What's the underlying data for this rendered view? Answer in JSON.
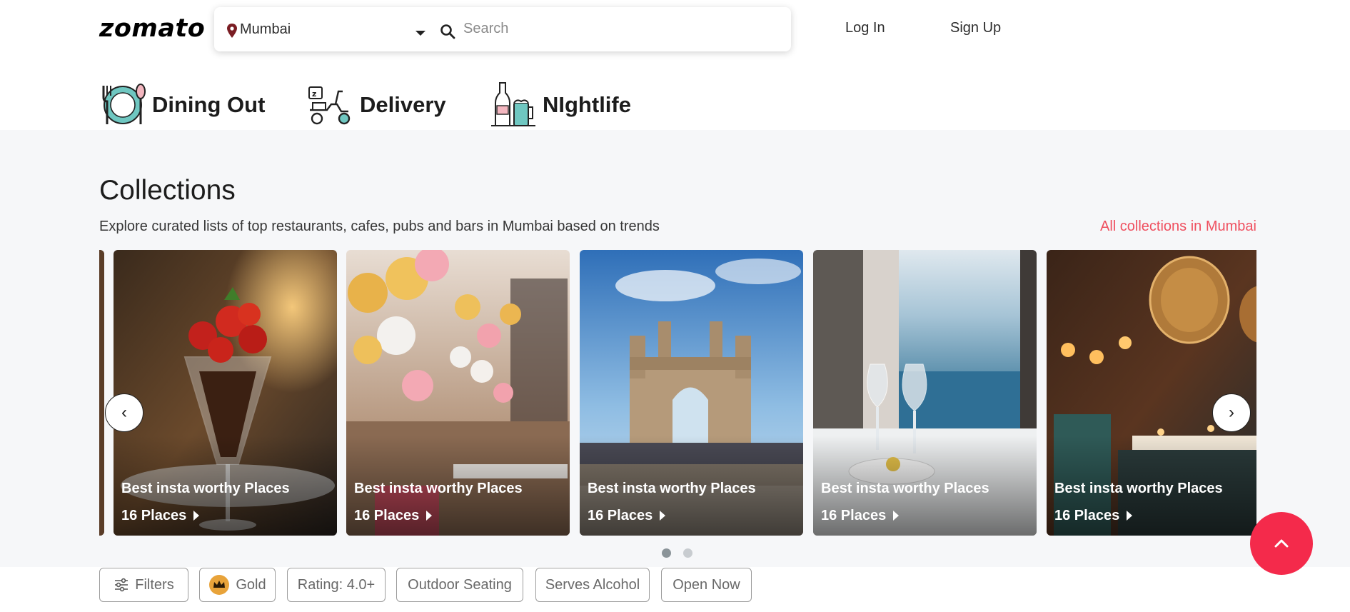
{
  "header": {
    "logo": "zomato",
    "location": "Mumbai",
    "search_placeholder": "Search",
    "login": "Log In",
    "signup": "Sign Up"
  },
  "categories": [
    {
      "label": "Dining Out",
      "icon": "dining-out-icon"
    },
    {
      "label": "Delivery",
      "icon": "delivery-scooter-icon"
    },
    {
      "label": "NIghtlife",
      "icon": "nightlife-drinks-icon"
    }
  ],
  "collections": {
    "title": "Collections",
    "subtitle": "Explore curated lists of top restaurants, cafes, pubs and bars in Mumbai based on trends",
    "link": "All collections in Mumbai",
    "cards": [
      {
        "title": "Best insta worthy Places",
        "count": "16 Places"
      },
      {
        "title": "Best insta worthy Places",
        "count": "16 Places"
      },
      {
        "title": "Best insta worthy Places",
        "count": "16 Places"
      },
      {
        "title": "Best insta worthy Places",
        "count": "16 Places"
      },
      {
        "title": "Best insta worthy Places",
        "count": "16 Places"
      }
    ],
    "prev": "‹",
    "next": "›"
  },
  "filters": [
    "Filters",
    "Gold",
    "Rating: 4.0+",
    "Outdoor Seating",
    "Serves Alcohol",
    "Open Now"
  ],
  "colors": {
    "brand_red": "#ef4f5f",
    "scroll_button": "#f42a4b"
  }
}
